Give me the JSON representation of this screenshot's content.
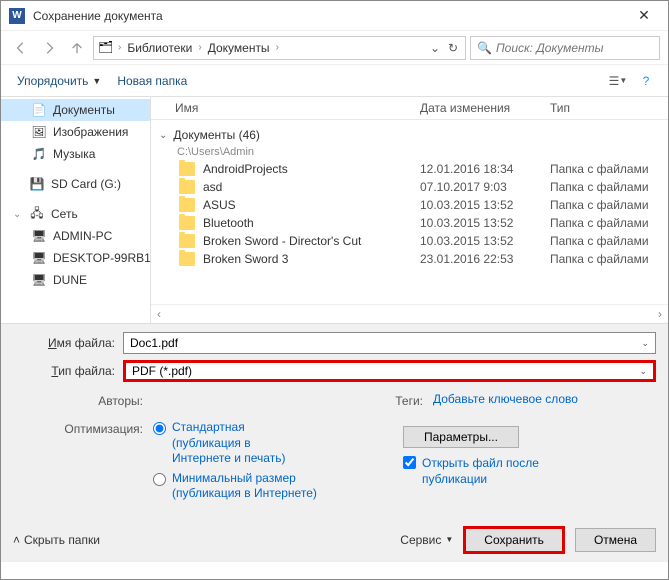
{
  "titlebar": {
    "title": "Сохранение документа"
  },
  "breadcrumb": {
    "root": "Библиотеки",
    "current": "Документы"
  },
  "search": {
    "placeholder": "Поиск: Документы"
  },
  "toolbar": {
    "organize": "Упорядочить",
    "newfolder": "Новая папка"
  },
  "sidebar": {
    "items": [
      {
        "label": "Документы",
        "icon": "📄",
        "level": 1,
        "selected": true
      },
      {
        "label": "Изображения",
        "icon": "🖼",
        "level": 1
      },
      {
        "label": "Музыка",
        "icon": "🎵",
        "level": 1
      },
      {
        "label": "SD Card (G:)",
        "icon": "💾",
        "level": 0,
        "expander": false
      },
      {
        "label": "Сеть",
        "icon": "🖧",
        "level": 0,
        "expander": true
      },
      {
        "label": "ADMIN-PC",
        "icon": "🖥",
        "level": 1
      },
      {
        "label": "DESKTOP-99RB1",
        "icon": "🖥",
        "level": 1
      },
      {
        "label": "DUNE",
        "icon": "🖥",
        "level": 1
      }
    ]
  },
  "columns": {
    "name": "Имя",
    "date": "Дата изменения",
    "type": "Тип"
  },
  "group": {
    "title": "Документы (46)",
    "path": "C:\\Users\\Admin"
  },
  "files": [
    {
      "name": "AndroidProjects",
      "date": "12.01.2016 18:34",
      "type": "Папка с файлами"
    },
    {
      "name": "asd",
      "date": "07.10.2017 9:03",
      "type": "Папка с файлами"
    },
    {
      "name": "ASUS",
      "date": "10.03.2015 13:52",
      "type": "Папка с файлами"
    },
    {
      "name": "Bluetooth",
      "date": "10.03.2015 13:52",
      "type": "Папка с файлами"
    },
    {
      "name": "Broken Sword - Director's Cut",
      "date": "10.03.2015 13:52",
      "type": "Папка с файлами"
    },
    {
      "name": "Broken Sword 3",
      "date": "23.01.2016 22:53",
      "type": "Папка с файлами"
    }
  ],
  "form": {
    "filename_label": "Имя файла:",
    "filename_value": "Doc1.pdf",
    "filetype_label": "Тип файла:",
    "filetype_value": "PDF (*.pdf)",
    "authors_label": "Авторы:",
    "tags_label": "Теги:",
    "tags_value": "Добавьте ключевое слово",
    "optimize_label": "Оптимизация:",
    "opt_standard": "Стандартная (публикация в Интернете и печать)",
    "opt_minimal": "Минимальный размер (публикация в Интернете)",
    "params_button": "Параметры...",
    "open_after": "Открыть файл после публикации"
  },
  "actions": {
    "hide_folders": "Скрыть папки",
    "tools": "Сервис",
    "save": "Сохранить",
    "cancel": "Отмена"
  }
}
